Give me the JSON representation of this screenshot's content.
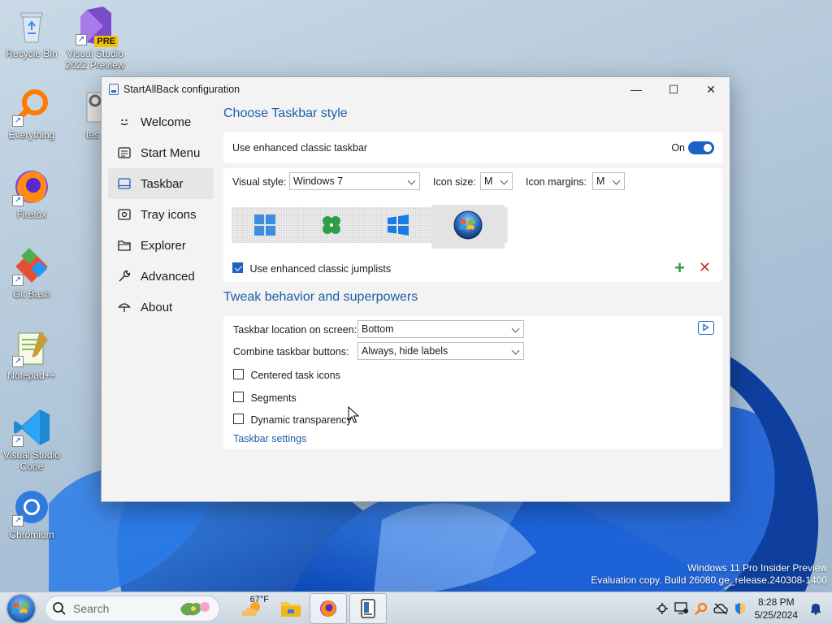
{
  "desktop": {
    "icons": [
      {
        "label": "Recycle Bin"
      },
      {
        "label": "Visual Studio 2022 Preview",
        "badge": "PRE"
      },
      {
        "label": "Everything"
      },
      {
        "label": "tes"
      },
      {
        "label": "Firefox"
      },
      {
        "label": "Git Bash"
      },
      {
        "label": "Notepad++"
      },
      {
        "label": "Visual Studio Code"
      },
      {
        "label": "Chromium"
      }
    ],
    "watermark_line1": "Windows 11 Pro Insider Preview",
    "watermark_line2": "Evaluation copy. Build 26080.ge_release.240308-1400"
  },
  "window": {
    "title": "StartAllBack configuration",
    "controls": {
      "minimize": "—",
      "maximize": "☐",
      "close": "✕"
    }
  },
  "sidebar": {
    "items": [
      {
        "label": "Welcome",
        "icon": "smile-icon"
      },
      {
        "label": "Start Menu",
        "icon": "start-menu-icon"
      },
      {
        "label": "Taskbar",
        "icon": "taskbar-icon",
        "active": true
      },
      {
        "label": "Tray icons",
        "icon": "tray-icon"
      },
      {
        "label": "Explorer",
        "icon": "folder-icon"
      },
      {
        "label": "Advanced",
        "icon": "wrench-icon"
      },
      {
        "label": "About",
        "icon": "umbrella-icon"
      }
    ]
  },
  "taskbar_style": {
    "title": "Choose Taskbar style",
    "enhanced_label": "Use enhanced classic taskbar",
    "enhanced_state": "On",
    "visual_style_label": "Visual style:",
    "visual_style_value": "Windows 7",
    "icon_size_label": "Icon size:",
    "icon_size_value": "M",
    "icon_margins_label": "Icon margins:",
    "icon_margins_value": "M",
    "style_options": [
      "windows-11-logo-icon",
      "clover-logo-icon",
      "windows-10-logo-icon",
      "windows-7-orb-icon"
    ],
    "selected_style_index": 3,
    "jumplists_label": "Use enhanced classic jumplists",
    "jumplists_checked": true,
    "add_symbol": "+",
    "remove_symbol": "✕"
  },
  "tweaks": {
    "title": "Tweak behavior and superpowers",
    "location_label": "Taskbar location on screen:",
    "location_value": "Bottom",
    "combine_label": "Combine taskbar buttons:",
    "combine_value": "Always, hide labels",
    "centered_label": "Centered task icons",
    "segments_label": "Segments",
    "transparency_label": "Dynamic transparency",
    "settings_link": "Taskbar settings"
  },
  "taskbar": {
    "search_placeholder": "Search",
    "weather": "67°F",
    "clock_time": "8:28 PM",
    "clock_date": "5/25/2024"
  },
  "colors": {
    "accent": "#1a62c6",
    "section_title": "#1e5ea8"
  }
}
